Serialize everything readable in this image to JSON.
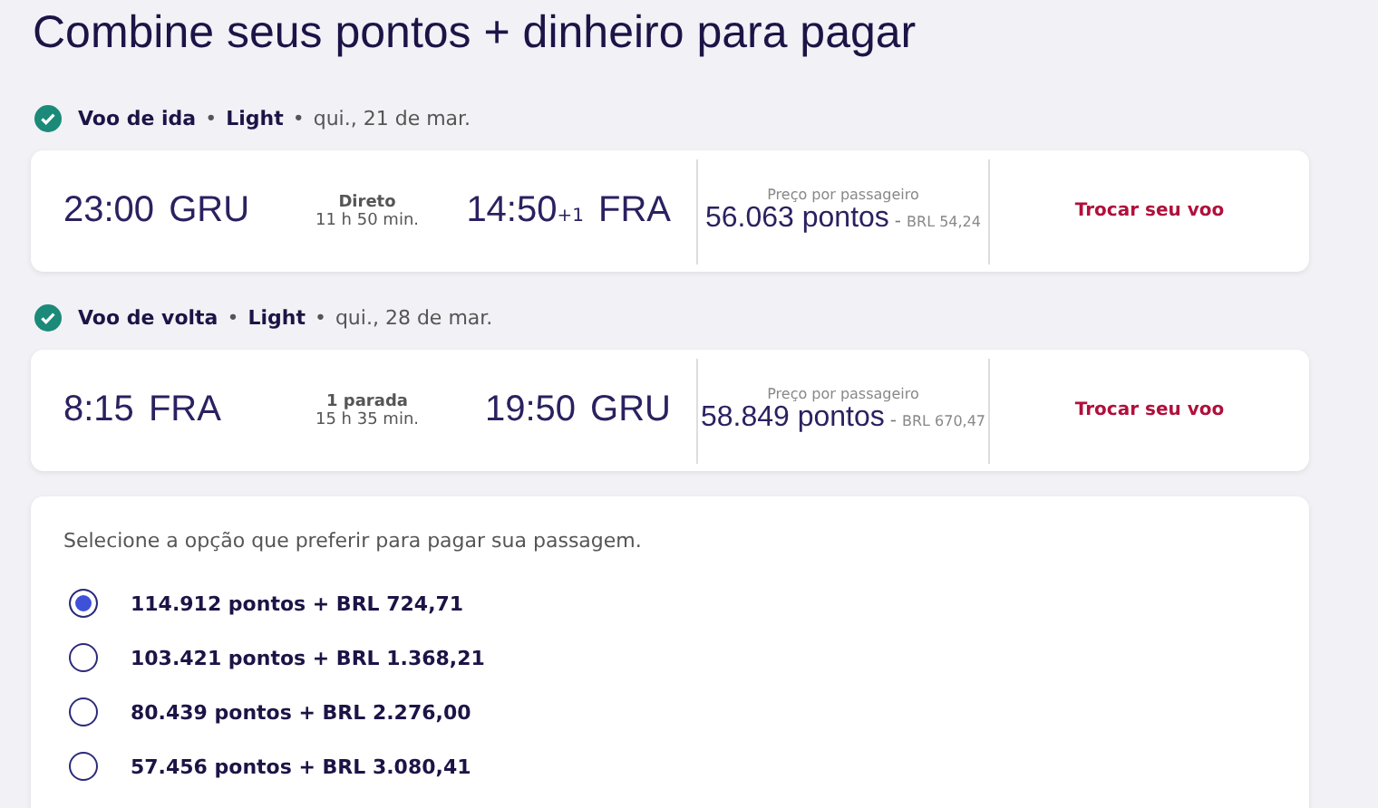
{
  "title": "Combine seus pontos + dinheiro para pagar",
  "flights": [
    {
      "direction": "Voo de ida",
      "dot_1": "•",
      "fare": "Light",
      "dot_2": "•",
      "date": "qui., 21 de mar.",
      "confirmed": true,
      "departure_time": "23:00",
      "departure_airport": "GRU",
      "stops": "Direto",
      "duration": "11 h 50 min.",
      "arrival_time": "14:50",
      "day_offset": "+1",
      "arrival_airport": "FRA",
      "price_label": "Preço por passageiro",
      "points": "56.063 pontos",
      "separator": "-",
      "cash": "BRL 54,24",
      "action": "Trocar seu voo"
    },
    {
      "direction": "Voo de volta",
      "dot_1": "•",
      "fare": "Light",
      "dot_2": "•",
      "date": "qui., 28 de mar.",
      "confirmed": true,
      "departure_time": "8:15",
      "departure_airport": "FRA",
      "stops": "1 parada",
      "duration": "15 h 35 min.",
      "arrival_time": "19:50",
      "arrival_airport": "GRU",
      "price_label": "Preço por passageiro",
      "points": "58.849 pontos",
      "separator": "-",
      "cash": "BRL 670,47",
      "action": "Trocar seu voo"
    }
  ],
  "payment": {
    "prompt": "Selecione a opção que preferir para pagar sua passagem.",
    "options": [
      {
        "label": "114.912 pontos + BRL 724,71",
        "selected": true
      },
      {
        "label": "103.421 pontos + BRL 1.368,21",
        "selected": false
      },
      {
        "label": "80.439 pontos + BRL 2.276,00",
        "selected": false
      },
      {
        "label": "57.456 pontos + BRL 3.080,41",
        "selected": false
      }
    ]
  }
}
